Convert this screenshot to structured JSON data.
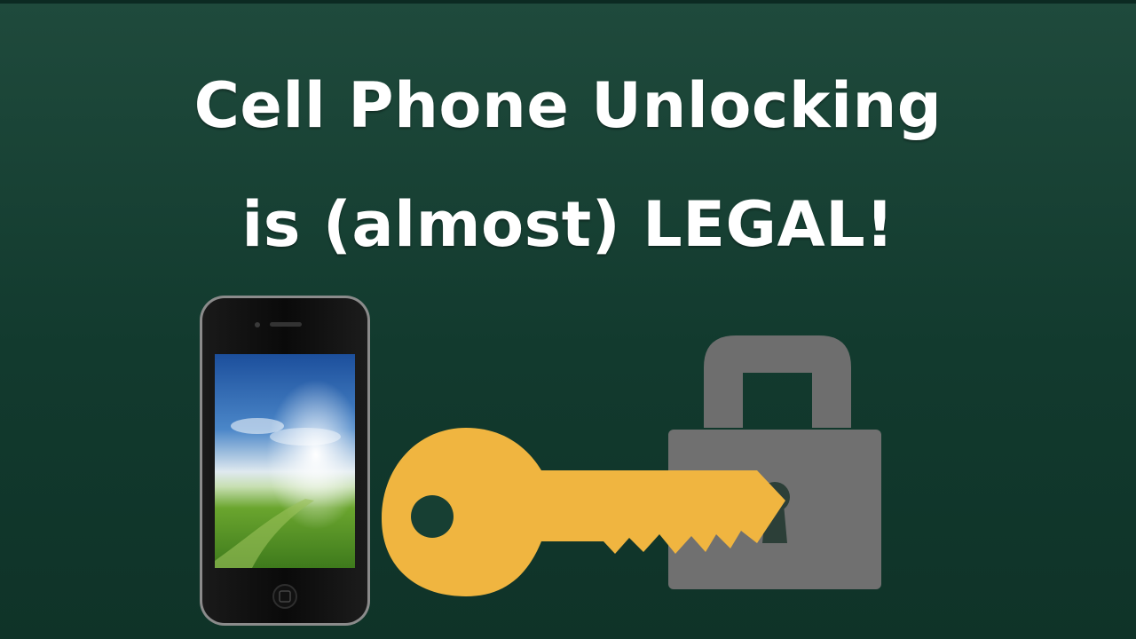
{
  "headline": {
    "line1": "Cell Phone Unlocking",
    "line2": "is (almost) LEGAL!"
  },
  "colors": {
    "background": "#163f33",
    "title_text": "#ffffff",
    "key": "#f0b540",
    "lock": "#6f6f6f"
  },
  "icons": [
    "smartphone-icon",
    "key-icon",
    "padlock-icon"
  ]
}
